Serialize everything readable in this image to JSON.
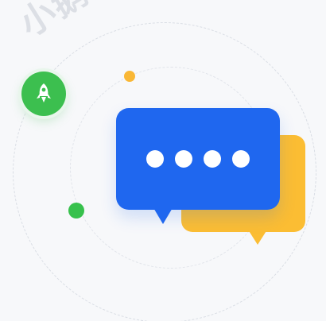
{
  "watermark": {
    "text": "小鹅通"
  },
  "icons": {
    "rocket": "rocket-icon",
    "chat": "chat-bubbles-icon",
    "typing": "typing-indicator"
  },
  "colors": {
    "background": "#f7f8fa",
    "front_bubble": "#1f67ef",
    "back_bubble": "#fbbd33",
    "green_accent": "#3cbf4f",
    "orange_accent": "#f9b735",
    "typing_dots": "#ffffff"
  },
  "typing_dots": 4
}
